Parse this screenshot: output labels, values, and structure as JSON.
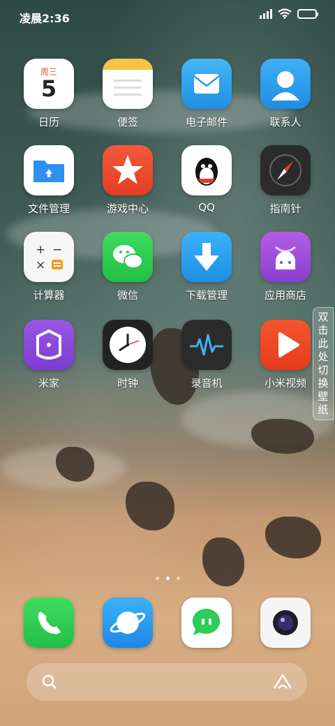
{
  "status_bar": {
    "time": "凌晨2:36"
  },
  "calendar": {
    "weekday": "周三",
    "day": "5"
  },
  "apps": [
    {
      "label": "日历"
    },
    {
      "label": "便签"
    },
    {
      "label": "电子邮件"
    },
    {
      "label": "联系人"
    },
    {
      "label": "文件管理"
    },
    {
      "label": "游戏中心"
    },
    {
      "label": "QQ"
    },
    {
      "label": "指南针"
    },
    {
      "label": "计算器"
    },
    {
      "label": "微信"
    },
    {
      "label": "下载管理"
    },
    {
      "label": "应用商店"
    },
    {
      "label": "米家"
    },
    {
      "label": "时钟"
    },
    {
      "label": "录音机"
    },
    {
      "label": "小米视频"
    }
  ],
  "wallpaper_switch": {
    "label": "双击此处切换壁纸"
  },
  "page_indicator": {
    "pages": 3,
    "current": 2
  },
  "dock": [
    {
      "name": "phone-icon"
    },
    {
      "name": "browser-icon"
    },
    {
      "name": "messages-icon"
    },
    {
      "name": "camera-icon"
    }
  ]
}
